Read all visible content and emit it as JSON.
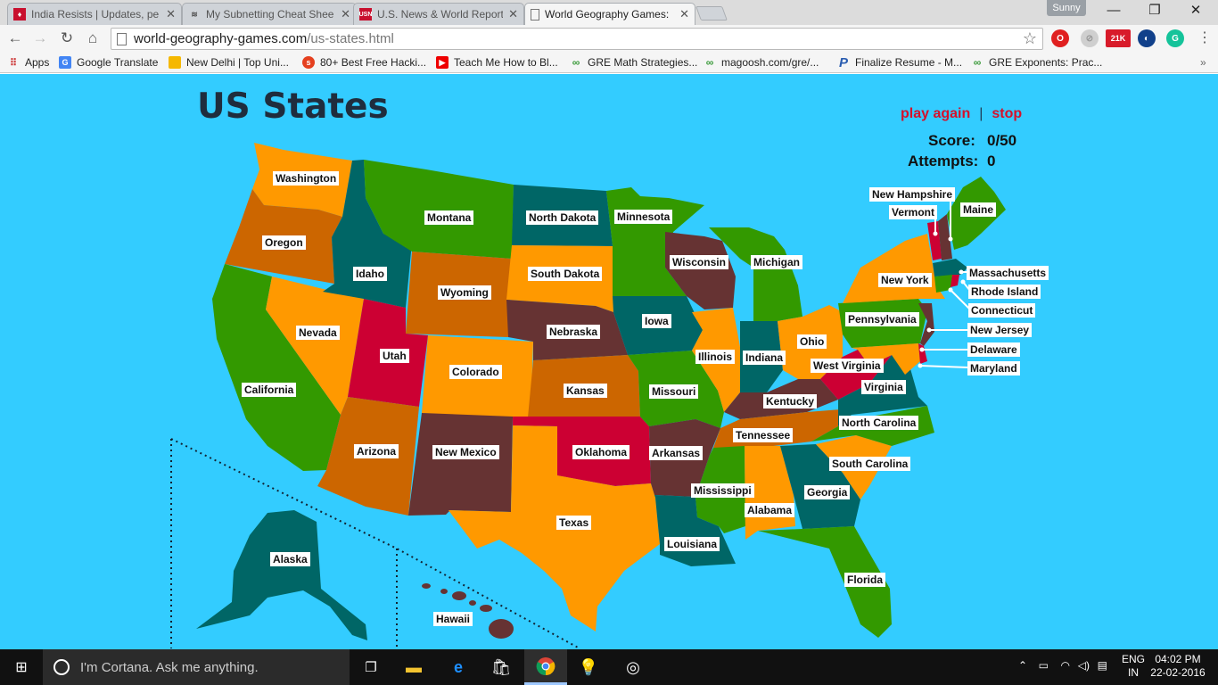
{
  "browser": {
    "tabs": [
      {
        "title": "India Resists | Updates, pe",
        "active": false
      },
      {
        "title": "My Subnetting Cheat Shee",
        "active": false
      },
      {
        "title": "U.S. News & World Report",
        "active": false
      },
      {
        "title": "World Geography Games:",
        "active": true
      }
    ],
    "user": "Sunny",
    "url_domain": "world-geography-games.com",
    "url_path": "/us-states.html",
    "bookmarks": [
      "Apps",
      "Google Translate",
      "New Delhi | Top Uni...",
      "80+ Best Free Hacki...",
      "Teach Me How to Bl...",
      "GRE Math Strategies...",
      "magoosh.com/gre/...",
      "Finalize Resume - M...",
      "GRE Exponents: Prac..."
    ],
    "ext_badge": "21K"
  },
  "game": {
    "title": "US States",
    "play_again": "play again",
    "separator": "|",
    "stop": "stop",
    "score_label": "Score:",
    "score_value": "0/50",
    "attempts_label": "Attempts:",
    "attempts_value": "0"
  },
  "states": [
    "Washington",
    "Oregon",
    "California",
    "Nevada",
    "Idaho",
    "Montana",
    "Wyoming",
    "Utah",
    "Arizona",
    "Colorado",
    "New Mexico",
    "North Dakota",
    "South Dakota",
    "Nebraska",
    "Kansas",
    "Oklahoma",
    "Texas",
    "Minnesota",
    "Iowa",
    "Missouri",
    "Arkansas",
    "Louisiana",
    "Wisconsin",
    "Illinois",
    "Mississippi",
    "Michigan",
    "Indiana",
    "Kentucky",
    "Tennessee",
    "Alabama",
    "Ohio",
    "Georgia",
    "Florida",
    "South Carolina",
    "North Carolina",
    "Virginia",
    "West Virginia",
    "Pennsylvania",
    "New York",
    "Vermont",
    "New Hampshire",
    "Maine",
    "Massachusetts",
    "Rhode Island",
    "Connecticut",
    "New Jersey",
    "Delaware",
    "Maryland",
    "Alaska",
    "Hawaii"
  ],
  "colors": {
    "ocean": "#33ccff",
    "orange": "#ff9900",
    "green": "#339900",
    "teal": "#006666",
    "brown": "#663333",
    "rust": "#cc6600",
    "red": "#cc0033",
    "accent": "#d6102a"
  },
  "taskbar": {
    "search_placeholder": "I'm Cortana. Ask me anything.",
    "lang": "ENG",
    "region": "IN",
    "time": "04:02 PM",
    "date": "22-02-2016"
  }
}
